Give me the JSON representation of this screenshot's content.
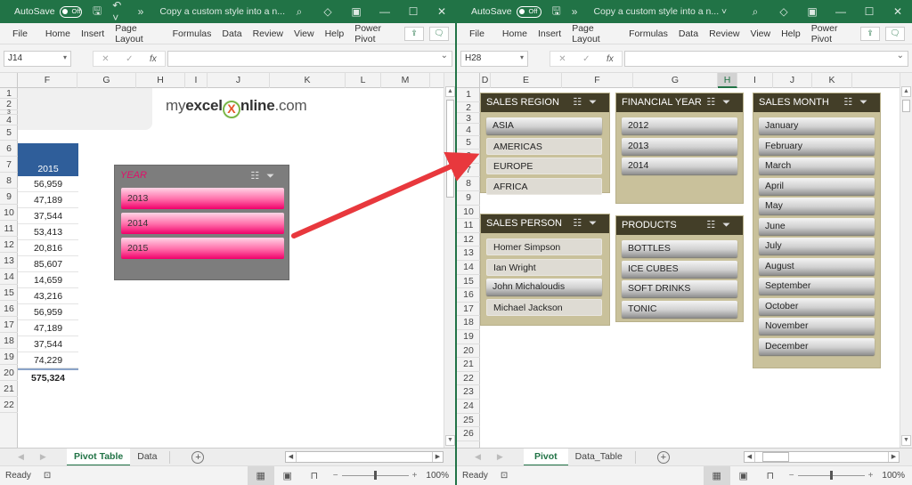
{
  "left": {
    "title": {
      "autosave": "AutoSave",
      "toggle": "Off",
      "doc": "Copy a custom style into a n..."
    },
    "menu": [
      "File",
      "Home",
      "Insert",
      "Page Layout",
      "Formulas",
      "Data",
      "Review",
      "View",
      "Help",
      "Power Pivot"
    ],
    "namebox": "J14",
    "columns": [
      "F",
      "G",
      "H",
      "I",
      "J",
      "K",
      "L",
      "M"
    ],
    "rows": [
      "1",
      "2",
      "3",
      "4",
      "5",
      "6",
      "7",
      "8",
      "9",
      "10",
      "11",
      "12",
      "13",
      "14",
      "15",
      "16",
      "17",
      "18",
      "19",
      "20",
      "21",
      "22"
    ],
    "logo": {
      "pre": "my",
      "bold": "excel",
      "x": "X",
      "mid": "nline",
      "suffix": ".com"
    },
    "pivot_header": "2015",
    "values": [
      "56,959",
      "47,189",
      "37,544",
      "53,413",
      "20,816",
      "85,607",
      "14,659",
      "43,216",
      "56,959",
      "47,189",
      "37,544",
      "74,229"
    ],
    "total": "575,324",
    "slicer": {
      "title": "YEAR",
      "items": [
        "2013",
        "2014",
        "2015"
      ]
    },
    "tabs": [
      "Pivot Table",
      "Data"
    ],
    "active_tab": "Pivot Table",
    "status": "Ready",
    "zoom": "100%"
  },
  "right": {
    "title": {
      "autosave": "AutoSave",
      "toggle": "Off",
      "doc": "Copy a custom style into a n..."
    },
    "menu": [
      "File",
      "Home",
      "Insert",
      "Page Layout",
      "Formulas",
      "Data",
      "Review",
      "View",
      "Help",
      "Power Pivot"
    ],
    "namebox": "H28",
    "columns": [
      "D",
      "E",
      "F",
      "G",
      "H",
      "I",
      "J",
      "K"
    ],
    "active_column": "H",
    "rows": [
      "1",
      "2",
      "3",
      "4",
      "5",
      "6",
      "7",
      "8",
      "9",
      "10",
      "11",
      "12",
      "13",
      "14",
      "15",
      "16",
      "17",
      "18",
      "19",
      "20",
      "21",
      "22",
      "23",
      "24",
      "25",
      "26"
    ],
    "slicers": {
      "region": {
        "title": "SALES REGION",
        "items": [
          "ASIA",
          "AMERICAS",
          "EUROPE",
          "AFRICA"
        ],
        "selected": [
          "ASIA"
        ]
      },
      "fy": {
        "title": "FINANCIAL YEAR",
        "items": [
          "2012",
          "2013",
          "2014"
        ],
        "selected": [
          "2012",
          "2013",
          "2014"
        ]
      },
      "month": {
        "title": "SALES MONTH",
        "items": [
          "January",
          "February",
          "March",
          "April",
          "May",
          "June",
          "July",
          "August",
          "September",
          "October",
          "November",
          "December"
        ]
      },
      "person": {
        "title": "SALES PERSON",
        "items": [
          "Homer Simpson",
          "Ian Wright",
          "John Michaloudis",
          "Michael Jackson"
        ],
        "selected": [
          "John Michaloudis"
        ]
      },
      "products": {
        "title": "PRODUCTS",
        "items": [
          "BOTTLES",
          "ICE CUBES",
          "SOFT DRINKS",
          "TONIC"
        ]
      }
    },
    "tabs": [
      "Pivot",
      "Data_Table"
    ],
    "active_tab": "Pivot",
    "status": "Ready",
    "zoom": "100%"
  },
  "colors": {
    "excel_green": "#217346",
    "slicer_header": "#433e28",
    "slicer_body": "#c9c19b",
    "pink": "#f0006a",
    "pivot_blue": "#2f5e9a",
    "arrow": "#e8383d"
  }
}
